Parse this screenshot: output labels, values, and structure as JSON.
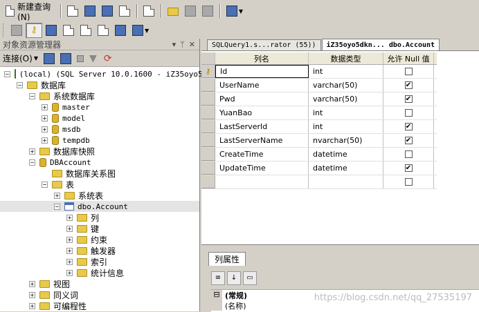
{
  "toolbar1": {
    "new_query_label": "新建查询(N)"
  },
  "object_explorer": {
    "title": "对象资源管理器",
    "connect_label": "连接(O)",
    "tree": [
      {
        "label": "(local) (SQL Server 10.0.1600 - iZ35oyo5",
        "level": 0,
        "expander": "−",
        "icon": "server"
      },
      {
        "label": "数据库",
        "level": 1,
        "expander": "−",
        "icon": "folder"
      },
      {
        "label": "系统数据库",
        "level": 2,
        "expander": "−",
        "icon": "folder"
      },
      {
        "label": "master",
        "level": 3,
        "expander": "+",
        "icon": "db"
      },
      {
        "label": "model",
        "level": 3,
        "expander": "+",
        "icon": "db"
      },
      {
        "label": "msdb",
        "level": 3,
        "expander": "+",
        "icon": "db"
      },
      {
        "label": "tempdb",
        "level": 3,
        "expander": "+",
        "icon": "db"
      },
      {
        "label": "数据库快照",
        "level": 2,
        "expander": "+",
        "icon": "folder"
      },
      {
        "label": "DBAccount",
        "level": 2,
        "expander": "−",
        "icon": "db"
      },
      {
        "label": "数据库关系图",
        "level": 3,
        "expander": "",
        "icon": "folder"
      },
      {
        "label": "表",
        "level": 3,
        "expander": "−",
        "icon": "folder"
      },
      {
        "label": "系统表",
        "level": 4,
        "expander": "+",
        "icon": "folder"
      },
      {
        "label": "dbo.Account",
        "level": 4,
        "expander": "−",
        "icon": "table",
        "selected": true
      },
      {
        "label": "列",
        "level": 5,
        "expander": "+",
        "icon": "folder"
      },
      {
        "label": "键",
        "level": 5,
        "expander": "+",
        "icon": "folder"
      },
      {
        "label": "约束",
        "level": 5,
        "expander": "+",
        "icon": "folder"
      },
      {
        "label": "触发器",
        "level": 5,
        "expander": "+",
        "icon": "folder"
      },
      {
        "label": "索引",
        "level": 5,
        "expander": "+",
        "icon": "folder"
      },
      {
        "label": "统计信息",
        "level": 5,
        "expander": "+",
        "icon": "folder"
      },
      {
        "label": "视图",
        "level": 2,
        "expander": "+",
        "icon": "folder"
      },
      {
        "label": "同义词",
        "level": 2,
        "expander": "+",
        "icon": "folder"
      },
      {
        "label": "可编程性",
        "level": 2,
        "expander": "+",
        "icon": "folder"
      }
    ]
  },
  "tabs": [
    {
      "label": "SQLQuery1.s...rator (55))",
      "active": false
    },
    {
      "label": "iZ35oyo5dkn... dbo.Account",
      "active": true
    }
  ],
  "grid": {
    "headers": [
      "列名",
      "数据类型",
      "允许 Null 值"
    ],
    "rows": [
      {
        "name": "Id",
        "type": "int",
        "nullable": false,
        "key": true,
        "editing": true
      },
      {
        "name": "UserName",
        "type": "varchar(50)",
        "nullable": true
      },
      {
        "name": "Pwd",
        "type": "varchar(50)",
        "nullable": true
      },
      {
        "name": "YuanBao",
        "type": "int",
        "nullable": false
      },
      {
        "name": "LastServerId",
        "type": "int",
        "nullable": true
      },
      {
        "name": "LastServerName",
        "type": "nvarchar(50)",
        "nullable": true
      },
      {
        "name": "CreateTime",
        "type": "datetime",
        "nullable": false
      },
      {
        "name": "UpdateTime",
        "type": "datetime",
        "nullable": true
      },
      {
        "name": "",
        "type": "",
        "nullable": false
      }
    ]
  },
  "properties": {
    "tab_label": "列属性",
    "rows": [
      {
        "expander": "⊟",
        "label": "(常规)",
        "bold": true
      },
      {
        "expander": "",
        "label": "(名称)",
        "bold": false
      }
    ]
  },
  "watermark": "https://blog.csdn.net/qq_27535197"
}
